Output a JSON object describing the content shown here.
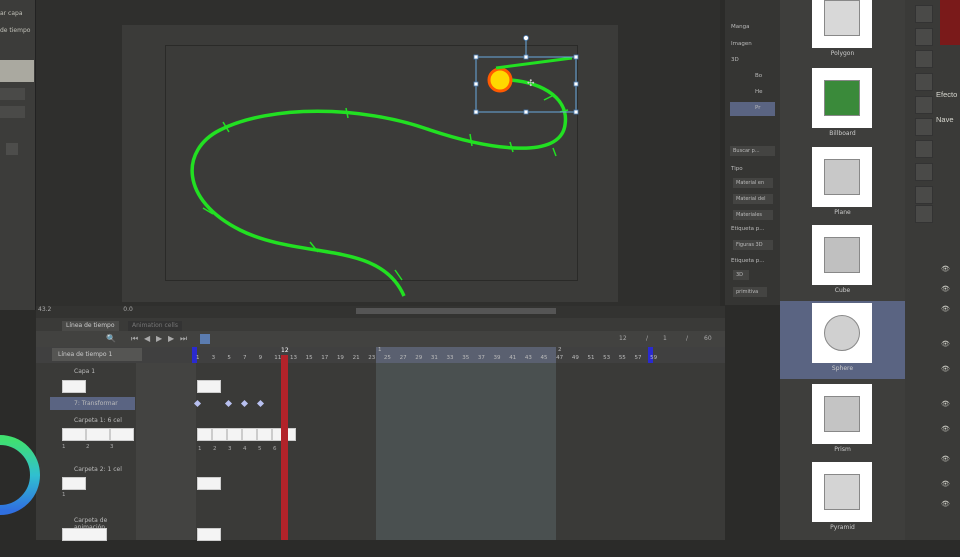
{
  "left_panel": {
    "item1": "ar capa",
    "item2": "de tiempo"
  },
  "status": {
    "zoom": "43.2",
    "angle": "0.0"
  },
  "timeline": {
    "tabs": [
      "Línea de tiempo",
      "Animation cells"
    ],
    "selector": "Línea de tiempo 1",
    "current_frame": "12",
    "sep1": "/",
    "start": "1",
    "sep2": "/",
    "end": "60",
    "ruler": [
      "1",
      "3",
      "5",
      "7",
      "9",
      "11",
      "13",
      "15",
      "17",
      "19",
      "21",
      "23",
      "25",
      "27",
      "29",
      "31",
      "33",
      "35",
      "37",
      "39",
      "41",
      "43",
      "45",
      "47",
      "49",
      "51",
      "53",
      "55",
      "57",
      "59"
    ],
    "playhead": "12",
    "markers": [
      "1",
      "2"
    ],
    "layers": [
      {
        "name": "Capa 1"
      },
      {
        "name": "7: Transformar"
      },
      {
        "name": "Carpeta 1: 6 cel"
      },
      {
        "name": "Carpeta 2: 1 cel"
      },
      {
        "name": "Carpeta de animación"
      }
    ],
    "cell_numbers_left": [
      "1",
      "2",
      "3"
    ],
    "cell_numbers": [
      "1",
      "2",
      "3",
      "4",
      "5",
      "6"
    ],
    "cell_number_folder2": "1"
  },
  "material_tree": {
    "items": [
      "Manga",
      "Imagen",
      "3D",
      "Bo",
      "He",
      "Pr"
    ],
    "search": "Buscar p...",
    "tipo": "Tipo",
    "type_buttons": [
      "Material en",
      "Material del",
      "Materiales"
    ],
    "tag_label1": "Etiqueta p...",
    "tag1": "Figuras 3D",
    "tag_label2": "Etiqueta p...",
    "tag2": "3D",
    "tag3": "primitiva"
  },
  "materials": [
    {
      "label": "Polygon",
      "selected": false
    },
    {
      "label": "Billboard",
      "selected": false
    },
    {
      "label": "Plane",
      "selected": false
    },
    {
      "label": "Cube",
      "selected": false
    },
    {
      "label": "Sphere",
      "selected": true
    },
    {
      "label": "Prism",
      "selected": false
    },
    {
      "label": "Pyramid",
      "selected": false
    }
  ],
  "right_panel": {
    "label1": "Efecto",
    "label2": "Nave"
  },
  "colors": {
    "curve": "#22e022",
    "playhead": "#b2232a",
    "selection": "#5a6482"
  }
}
